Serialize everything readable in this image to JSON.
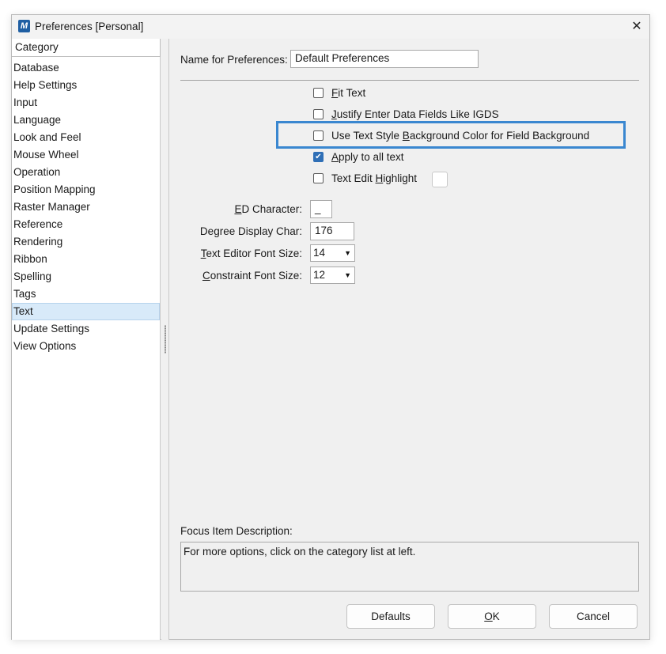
{
  "window": {
    "title": "Preferences [Personal]",
    "app_icon": "microstation-icon",
    "close_glyph": "✕"
  },
  "category": {
    "header": "Category",
    "items": [
      "Database",
      "Help Settings",
      "Input",
      "Language",
      "Look and Feel",
      "Mouse Wheel",
      "Operation",
      "Position Mapping",
      "Raster Manager",
      "Reference",
      "Rendering",
      "Ribbon",
      "Spelling",
      "Tags",
      "Text",
      "Update Settings",
      "View Options"
    ],
    "selected": "Text"
  },
  "prefs_name": {
    "label": "Name for Preferences:",
    "value": "Default Preferences"
  },
  "options": {
    "fit_text": {
      "label_pre": "",
      "label_key": "F",
      "label_post": "it Text",
      "checked": false
    },
    "justify": {
      "label_pre": "",
      "label_key": "J",
      "label_post": "ustify Enter Data Fields Like IGDS",
      "checked": false
    },
    "text_style_bg": {
      "label_pre": "Use Text Style ",
      "label_key": "B",
      "label_post": "ackground Color for Field Background",
      "checked": false
    },
    "apply_all": {
      "label_pre": "",
      "label_key": "A",
      "label_post": "pply to all text",
      "checked": true
    },
    "edit_highlight": {
      "label_pre": "Text Edit ",
      "label_key": "H",
      "label_post": "ighlight",
      "checked": false
    }
  },
  "fields": {
    "ed_char": {
      "label_pre": "",
      "label_key": "E",
      "label_post": "D Character:",
      "value": "_"
    },
    "degree_char": {
      "label_pre": "De",
      "label_key": "g",
      "label_post": "ree Display Char:",
      "value": "176"
    },
    "editor_font": {
      "label_pre": "",
      "label_key": "T",
      "label_post": "ext Editor Font Size:",
      "value": "14"
    },
    "constraint_font": {
      "label_pre": "",
      "label_key": "C",
      "label_post": "onstraint Font Size:",
      "value": "12"
    }
  },
  "focus": {
    "label": "Focus Item Description:",
    "text": "For more options, click on the category list at left."
  },
  "buttons": {
    "defaults": "Defaults",
    "ok_key": "O",
    "ok_post": "K",
    "cancel": "Cancel"
  },
  "colors": {
    "highlight_border": "#3a87d0",
    "checkbox_checked": "#2f6fb6",
    "selected_row": "#d8eaf9"
  }
}
